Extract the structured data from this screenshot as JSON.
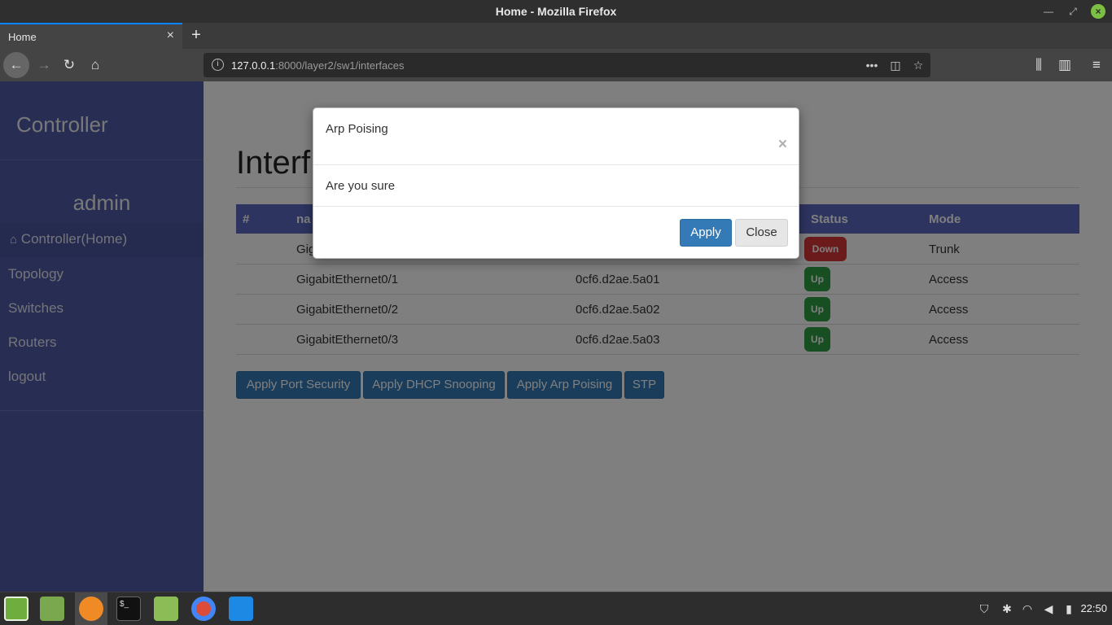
{
  "window": {
    "title": "Home - Mozilla Firefox"
  },
  "browser": {
    "tab_title": "Home",
    "url_host": "127.0.0.1",
    "url_path": ":8000/layer2/sw1/interfaces"
  },
  "sidebar": {
    "brand": "Controller",
    "user": "admin",
    "items": [
      {
        "label": "Controller(Home)",
        "icon": "home-icon"
      },
      {
        "label": "Topology"
      },
      {
        "label": "Switches"
      },
      {
        "label": "Routers"
      },
      {
        "label": "logout"
      }
    ]
  },
  "main": {
    "heading": "Interf",
    "table": {
      "headers": [
        "#",
        "na",
        "",
        "Status",
        "Mode"
      ],
      "rows": [
        {
          "name": "Gigab",
          "mac": "",
          "status": "Down",
          "mode": "Trunk"
        },
        {
          "name": "GigabitEthernet0/1",
          "mac": "0cf6.d2ae.5a01",
          "status": "Up",
          "mode": "Access"
        },
        {
          "name": "GigabitEthernet0/2",
          "mac": "0cf6.d2ae.5a02",
          "status": "Up",
          "mode": "Access"
        },
        {
          "name": "GigabitEthernet0/3",
          "mac": "0cf6.d2ae.5a03",
          "status": "Up",
          "mode": "Access"
        }
      ]
    },
    "actions": [
      "Apply Port Security",
      "Apply DHCP Snooping",
      "Apply Arp Poising",
      "STP"
    ]
  },
  "modal": {
    "title": "Arp Poising",
    "close_glyph": "×",
    "body": "Are you sure",
    "apply_label": "Apply",
    "close_label": "Close"
  },
  "taskbar": {
    "clock": "22:50"
  },
  "colors": {
    "sidebar": "#4e5ba6",
    "table_header": "#5a68c0",
    "primary": "#337ab7",
    "status_up": "#2f9e44",
    "status_down": "#d9373b"
  }
}
